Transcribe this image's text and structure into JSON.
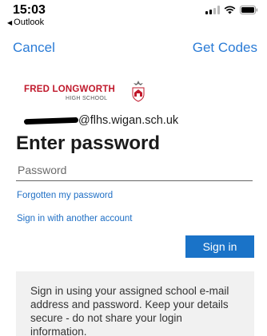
{
  "status_bar": {
    "time": "15:03",
    "back_app": "Outlook",
    "back_arrow_icon": "back-triangle-icon"
  },
  "nav": {
    "cancel_label": "Cancel",
    "get_codes_label": "Get Codes"
  },
  "logo": {
    "name_red": "FRED LONGWORTH",
    "subtitle": "HIGH SCHOOL"
  },
  "account": {
    "email_suffix": "@flhs.wigan.sch.uk"
  },
  "page_title": "Enter password",
  "password_field": {
    "placeholder": "Password",
    "value": ""
  },
  "links": {
    "forgot": "Forgotten my password",
    "other_account": "Sign in with another account"
  },
  "signin_button": "Sign in",
  "info_text": "Sign in using your assigned school e-mail address and password. Keep your details secure - do not share your login information.",
  "colors": {
    "link_blue": "#2a7bd6",
    "button_blue": "#1a73c8",
    "logo_red": "#c0182b",
    "info_bg": "#f1f1f1"
  }
}
